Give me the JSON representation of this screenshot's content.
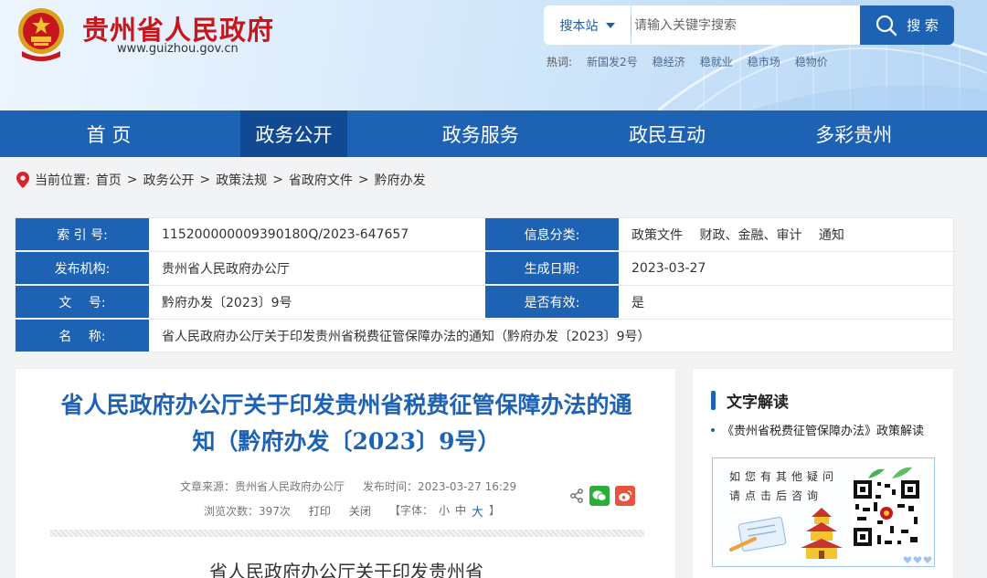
{
  "header": {
    "site_title": "贵州省人民政府",
    "site_url": "www.guizhou.gov.cn",
    "search": {
      "scope_label": "搜本站",
      "placeholder": "请输入关键字搜索",
      "button_label": "搜 索"
    },
    "hotwords_label": "热词:",
    "hotwords": [
      "新国发2号",
      "稳经济",
      "稳就业",
      "稳市场",
      "稳物价"
    ]
  },
  "nav": {
    "items": [
      "首 页",
      "政务公开",
      "政务服务",
      "政民互动",
      "多彩贵州"
    ],
    "active": "政务公开"
  },
  "breadcrumb": {
    "label": "当前位置:",
    "items": [
      "首页",
      "政务公开",
      "政策法规",
      "省政府文件",
      "黔府办发"
    ]
  },
  "info": {
    "index_label": "索 引 号:",
    "index_value": "115200000009390180Q/2023-647657",
    "category_label": "信息分类:",
    "category_value": "政策文件　 财政、金融、审计　 通知",
    "publisher_label": "发布机构:",
    "publisher_value": "贵州省人民政府办公厅",
    "date_label": "生成日期:",
    "date_value": "2023-03-27",
    "docno_label": "文　 号:",
    "docno_value": "黔府办发〔2023〕9号",
    "valid_label": "是否有效:",
    "valid_value": "是",
    "name_label": "名　 称:",
    "name_value": "省人民政府办公厅关于印发贵州省税费征管保障办法的通知（黔府办发〔2023〕9号）"
  },
  "article": {
    "title_line1": "省人民政府办公厅关于印发贵州省税费征管保障办法的通",
    "title_line2": "知（黔府办发〔2023〕9号）",
    "source": "文章来源：贵州省人民政府办公厅",
    "publish_time": "发布时间：2023-03-27 16:29",
    "views": "浏览次数：397次",
    "print_label": "打印",
    "close_label": "关闭",
    "font_label_open": "【字体：",
    "font_small": "小",
    "font_medium": "中",
    "font_large": "大",
    "font_label_close": "】",
    "doc_heading": "省人民政府办公厅关于印发贵州省"
  },
  "side": {
    "title": "文字解读",
    "link": "《贵州省税费征管保障办法》政策解读",
    "qa_text": "如您有其他疑问请点击后咨询"
  },
  "colors": {
    "primary": "#1e62b3",
    "nav_active": "#114a93",
    "title_red": "#c8161d",
    "wechat": "#2bad3a",
    "weibo": "#e8533c"
  }
}
